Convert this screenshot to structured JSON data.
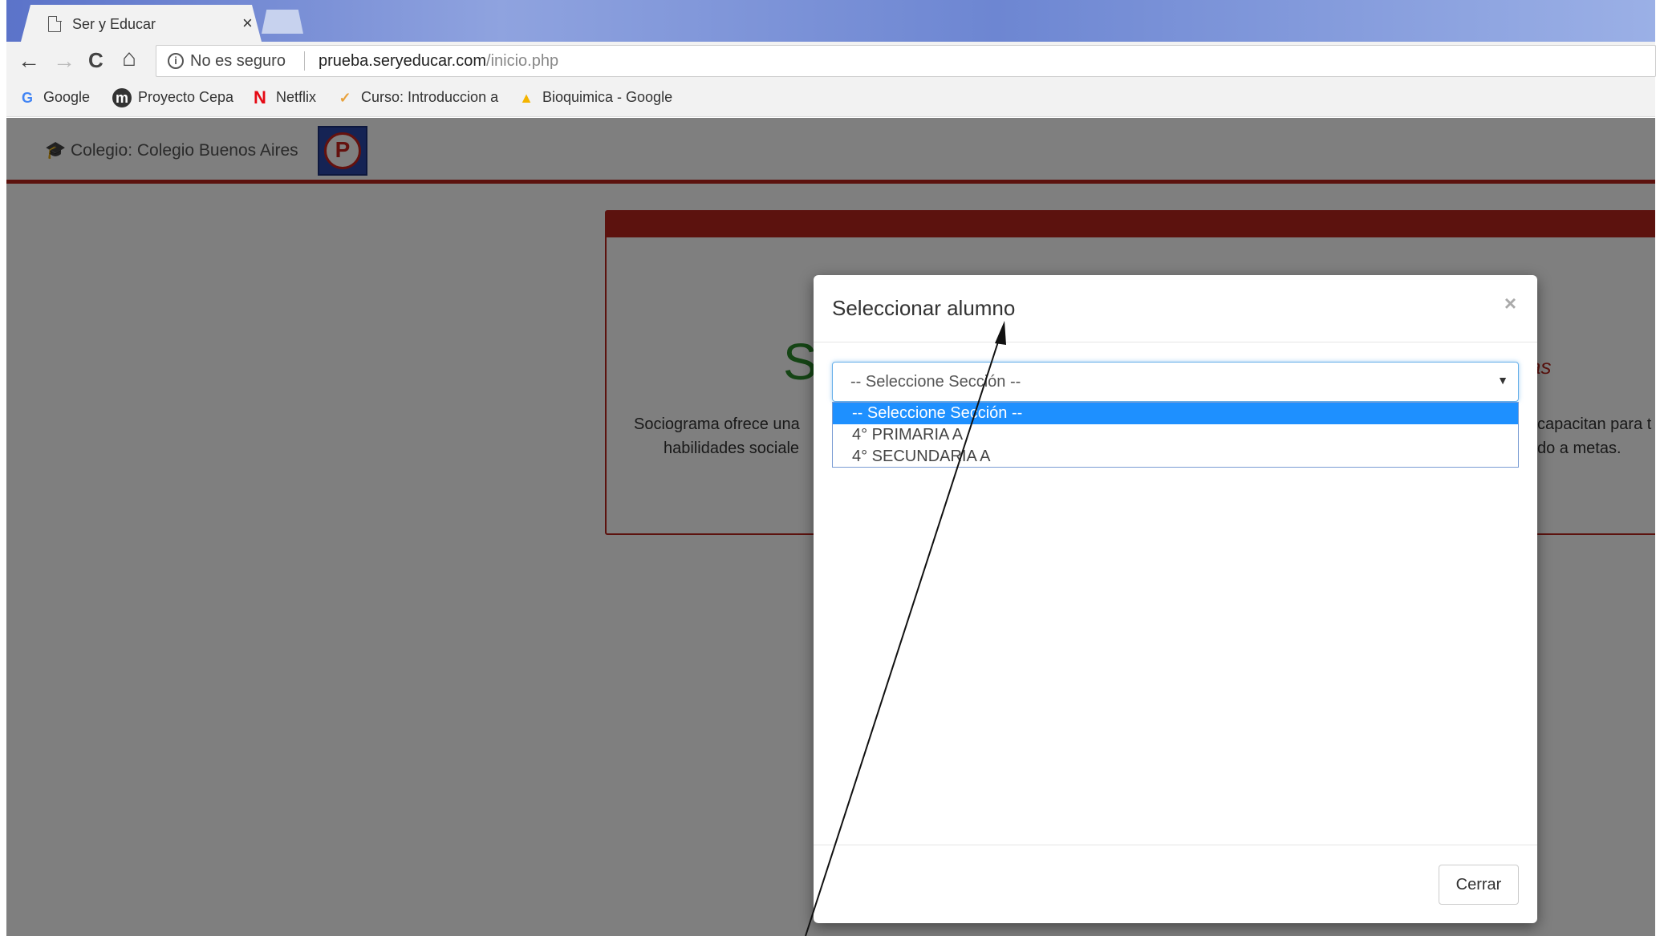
{
  "browser": {
    "tab_title": "Ser y Educar",
    "tab_close": "×",
    "back": "←",
    "forward": "→",
    "reload": "C",
    "home": "⌂",
    "security_text": "No es seguro",
    "url_host": "prueba.seryeducar.com",
    "url_path": "/inicio.php",
    "bookmarks": [
      {
        "label": "Google",
        "icon": "google-icon",
        "glyph": "G"
      },
      {
        "label": "Proyecto Cepa",
        "icon": "proyecto-cepa-icon",
        "glyph": "m"
      },
      {
        "label": "Netflix",
        "icon": "netflix-icon",
        "glyph": "N"
      },
      {
        "label": "Curso: Introduccion a",
        "icon": "curso-icon",
        "glyph": "✓"
      },
      {
        "label": "Bioquimica - Google",
        "icon": "google-drive-icon",
        "glyph": "▲"
      }
    ]
  },
  "page": {
    "school_label": "Colegio: Colegio Buenos Aires",
    "school_logo_letter": "P",
    "panel_big_partial": "S",
    "panel_red_partial": "as",
    "panel_left_line1": "Sociograma ofrece una",
    "panel_left_line2": "habilidades sociale",
    "panel_right_line1": "capacitan para t",
    "panel_right_line2": "do a metas."
  },
  "modal": {
    "title": "Seleccionar alumno",
    "close": "×",
    "select_value": "-- Seleccione Sección --",
    "options": [
      "-- Seleccione Sección --",
      "4° PRIMARIA A",
      "4° SECUNDARIA A"
    ],
    "selected_index": 0,
    "footer_button": "Cerrar"
  },
  "colors": {
    "brand_red": "#b8241c",
    "option_highlight": "#1e90ff",
    "focus_blue": "#66afe9"
  }
}
